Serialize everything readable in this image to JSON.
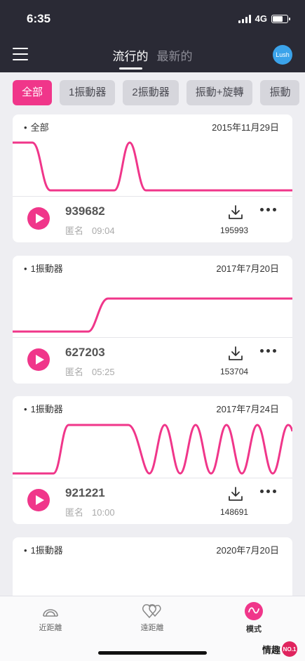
{
  "status": {
    "time": "6:35",
    "network": "4G"
  },
  "header": {
    "tabs": [
      {
        "label": "流行的"
      },
      {
        "label": "最新的"
      }
    ],
    "avatar_label": "Lush"
  },
  "filters": [
    {
      "label": "全部"
    },
    {
      "label": "1振動器"
    },
    {
      "label": "2振動器"
    },
    {
      "label": "振動+旋轉"
    },
    {
      "label": "振動"
    }
  ],
  "cards": [
    {
      "category": "全部",
      "date": "2015年11月29日",
      "id": "939682",
      "author": "匿名",
      "duration": "09:04",
      "downloads": "195993"
    },
    {
      "category": "1振動器",
      "date": "2017年7月20日",
      "id": "627203",
      "author": "匿名",
      "duration": "05:25",
      "downloads": "153704"
    },
    {
      "category": "1振動器",
      "date": "2017年7月24日",
      "id": "921221",
      "author": "匿名",
      "duration": "10:00",
      "downloads": "148691"
    },
    {
      "category": "1振動器",
      "date": "2020年7月20日"
    }
  ],
  "bottom_nav": [
    {
      "label": "近距離",
      "icon": "near-distance-icon"
    },
    {
      "label": "遠距離",
      "icon": "long-distance-hearts-icon"
    },
    {
      "label": "模式",
      "icon": "pattern-wave-icon"
    }
  ],
  "watermark": {
    "text": "情趣",
    "badge": "NO.1"
  },
  "colors": {
    "accent": "#f0368a",
    "header_bg": "#2a2a35",
    "page_bg": "#eeeef2",
    "avatar": "#3ba3ea"
  }
}
